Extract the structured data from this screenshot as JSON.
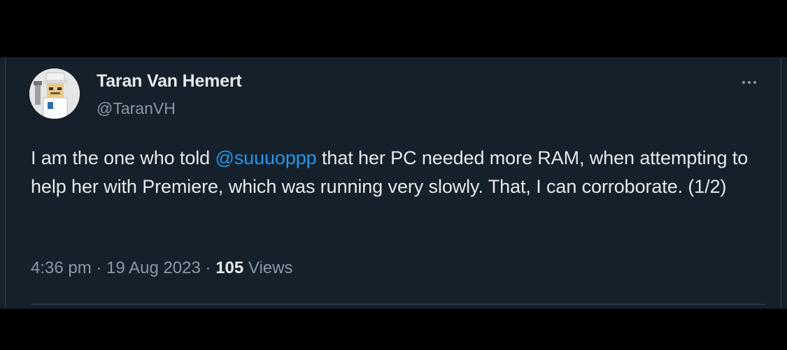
{
  "author": {
    "display_name": "Taran Van Hemert",
    "handle": "@TaranVH"
  },
  "tweet": {
    "text_before_mention": "I am the one who told ",
    "mention": "@suuuoppp",
    "text_after_mention": " that her PC needed more RAM, when attempting to help her with Premiere, which was running very slowly. That, I can corroborate. (1/2)"
  },
  "meta": {
    "time": "4:36 pm",
    "separator": " · ",
    "date": "19 Aug 2023",
    "views_count": "105",
    "views_label": " Views"
  },
  "icons": {
    "more": "more-options-icon",
    "avatar": "avatar-image"
  },
  "colors": {
    "background": "#15202b",
    "text": "#e7e9ea",
    "secondary": "#8b98a5",
    "link": "#1d9bf0"
  }
}
